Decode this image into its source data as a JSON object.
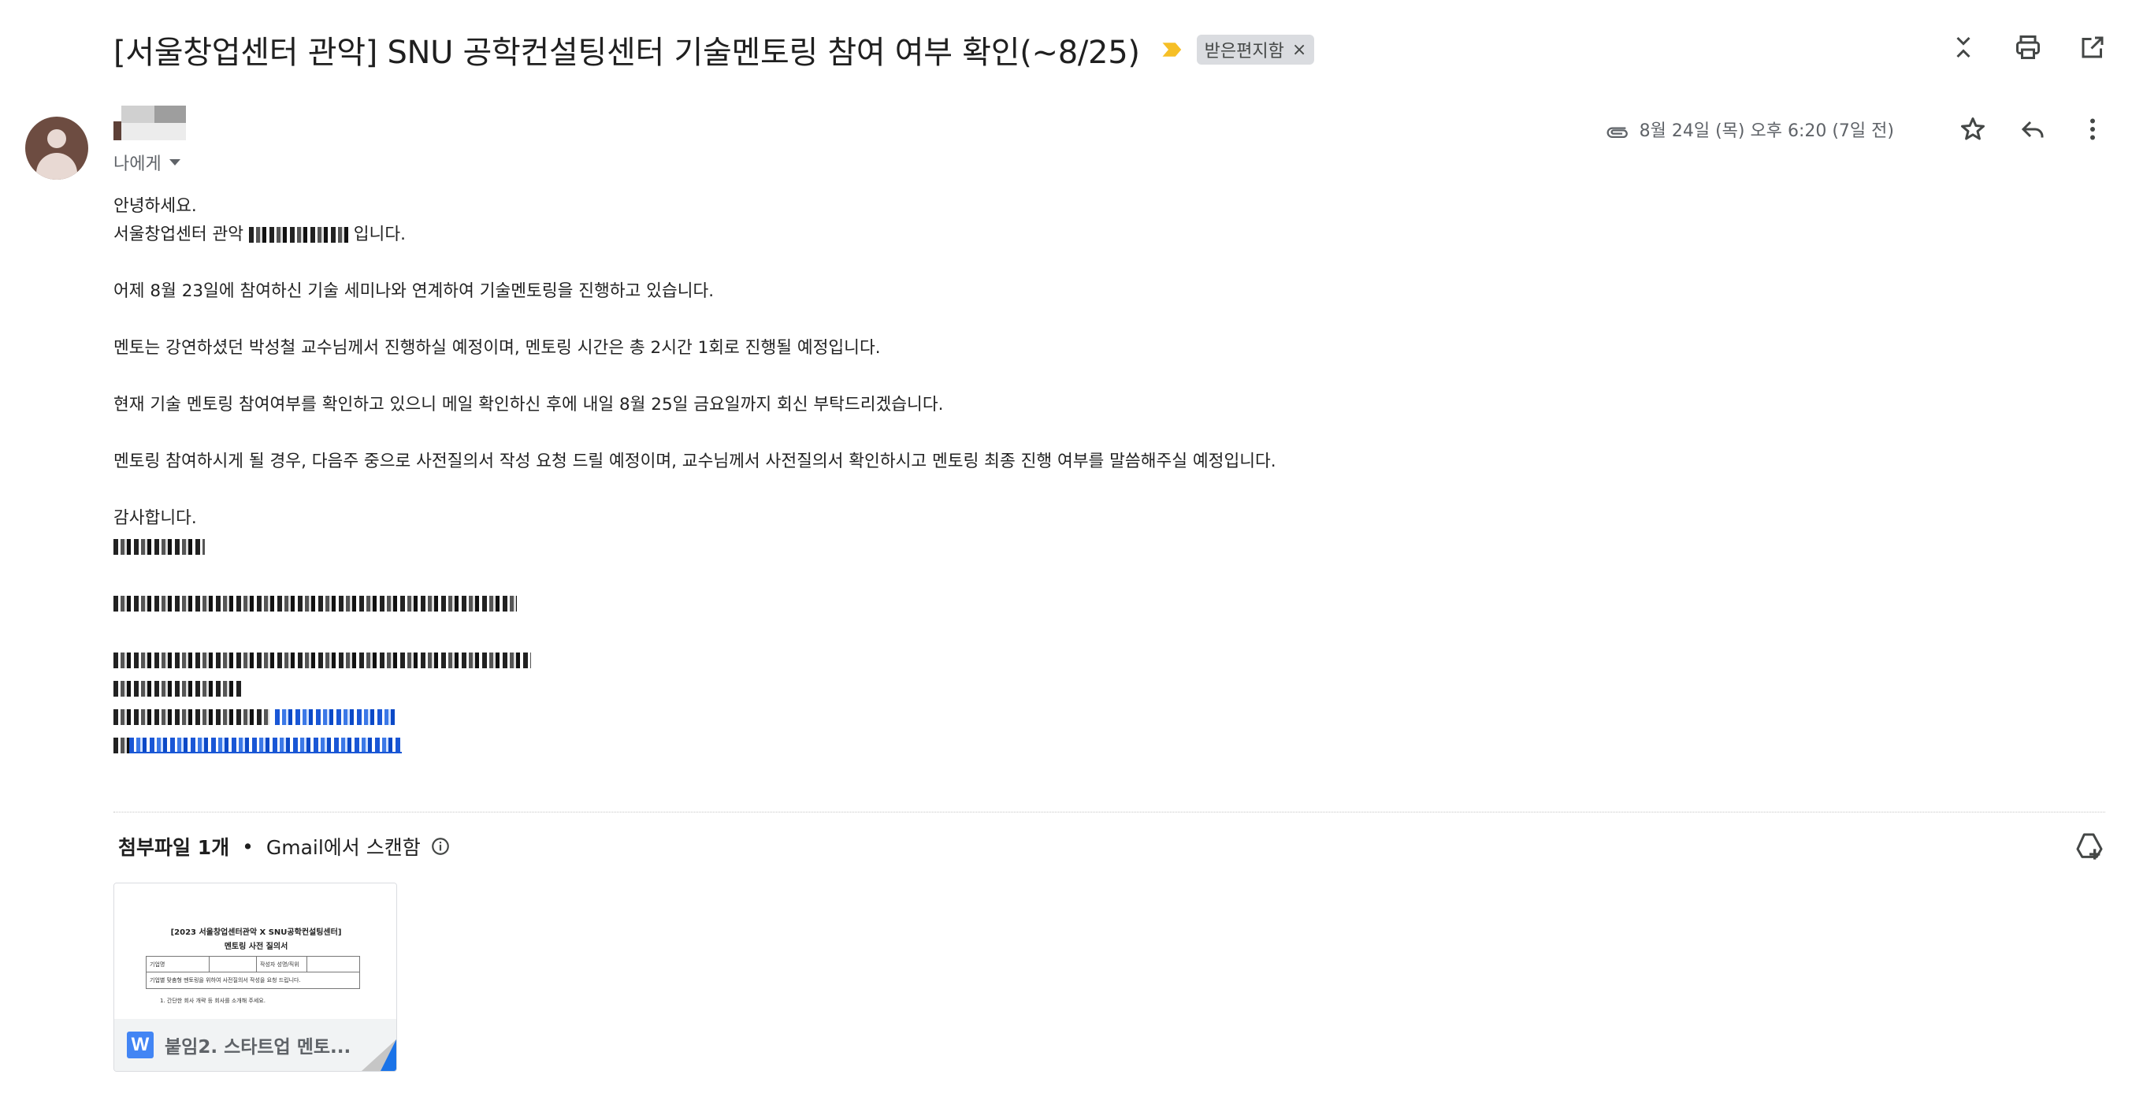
{
  "header": {
    "subject": "[서울창업센터 관악] SNU 공학컨설팅센터 기술멘토링 참여 여부 확인(~8/25)",
    "label": "받은편지함",
    "label_remove": "×",
    "importance_color": "#f6bf26"
  },
  "sender": {
    "recipient_label": "나에게",
    "date": "8월 24일 (목) 오후 6:20 (7일 전)",
    "avatar_color": "#6d4c41"
  },
  "body": {
    "greeting": "안녕하세요.",
    "intro_prefix": "서울창업센터 관악",
    "intro_suffix": "입니다.",
    "p1": "어제 8월 23일에 참여하신 기술 세미나와 연계하여 기술멘토링을 진행하고 있습니다.",
    "p2": "멘토는 강연하셨던 박성철 교수님께서 진행하실 예정이며, 멘토링 시간은 총 2시간 1회로 진행될 예정입니다.",
    "p3": "현재 기술 멘토링 참여여부를 확인하고 있으니 메일 확인하신 후에 내일 8월 25일 금요일까지 회신 부탁드리겠습니다.",
    "p4": "멘토링 참여하시게 될 경우, 다음주 중으로 사전질의서 작성 요청 드릴 예정이며, 교수님께서 사전질의서 확인하시고 멘토링 최종 진행 여부를 말씀해주실 예정입니다.",
    "closing": "감사합니다."
  },
  "attachments": {
    "count_label": "첨부파일 1개",
    "separator": "•",
    "scan_label": "Gmail에서 스캔함",
    "file_name": "붙임2. 스타트업 멘토...",
    "file_type_letter": "W",
    "preview": {
      "title_line1": "[2023 서울창업센터관악 X SNU공학컨설팅센터]",
      "title_line2": "멘토링 사전 질의서",
      "table_cell1": "기업명",
      "table_cell2": "작성자 성명/직위",
      "table_row2": "기업별 맞춤형 멘토링을 위하여 사전질의서 작성을 요청 드립니다.",
      "question1": "1. 간단한 회사 개략 등 회사를 소개해 주세요."
    }
  }
}
